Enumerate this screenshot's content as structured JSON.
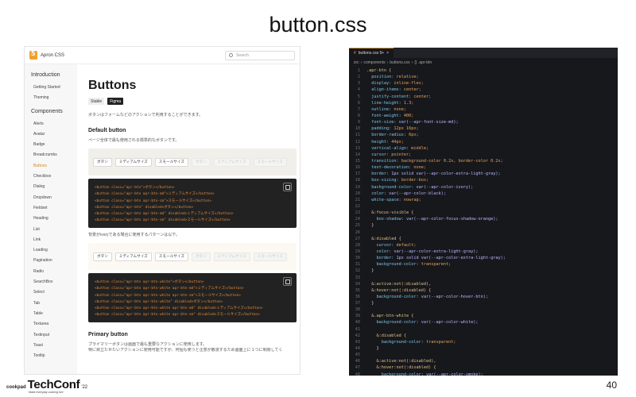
{
  "slide": {
    "title": "button.css",
    "page_number": "40"
  },
  "footer": {
    "cookpad": "cookpad",
    "techconf": "TechConf",
    "year": "'22",
    "tagline": "Make everyday cooking fun!"
  },
  "docs": {
    "brand": "Apron CSS",
    "search_placeholder": "Search",
    "sidebar": {
      "introduction_heading": "Introduction",
      "intro_items": [
        "Getting Started",
        "Theming"
      ],
      "components_heading": "Components",
      "component_items": [
        "Alerts",
        "Avatar",
        "Badge",
        "Breadcrumbs",
        "Buttons",
        "Checkbox",
        "Dialog",
        "Dropdown",
        "Fieldset",
        "Heading",
        "List",
        "Link",
        "Loading",
        "Pagination",
        "Radio",
        "SearchBox",
        "Select",
        "Tab",
        "Table",
        "Textarea",
        "Textinput",
        "Toast",
        "Tooltip"
      ],
      "active_item": "Buttons"
    },
    "page_title": "Buttons",
    "badge_storybook": "Stable",
    "badge_figma": "Figma",
    "intro_text": "ボタンはフォームなどのアクションで利用することができます。",
    "default_heading": "Default button",
    "default_text": "ページ全体で最も使用される標準的なボタンです。",
    "demo_buttons": [
      "ボタン",
      "ミディアムサイズ",
      "スモールサイズ",
      "ボタン",
      "ミディアムサイズ",
      "スモールサイズ"
    ],
    "code_block_1": [
      "<button class=\"apr-btn\">ボタン</button>",
      "<button class=\"apr-btn apr-btn-md\">ミディアムサイズ</button>",
      "<button class=\"apr-btn apr-btn-sm\">スモールサイズ</button>",
      "<button class=\"apr-btn\" disabled>ボタン</button>",
      "<button class=\"apr-btn apr-btn-md\" disabled>ミディアムサイズ</button>",
      "<button class=\"apr-btn apr-btn-sm\" disabled>スモールサイズ</button>"
    ],
    "ivory_text": "背景がivoryである場合に使用するパターンは以下。",
    "code_block_2": [
      "<button class=\"apr-btn apr-btn-white\">ボタン</button>",
      "<button class=\"apr-btn apr-btn-white apr-btn-md\">ミディアムサイズ</button>",
      "<button class=\"apr-btn apr-btn-white apr-btn-sm\">スモールサイズ</button>",
      "<button class=\"apr-btn apr-btn-white\" disabled>ボタン</button>",
      "<button class=\"apr-btn apr-btn-white apr-btn-md\" disabled>ミディアムサイズ</button>",
      "<button class=\"apr-btn apr-btn-white apr-btn-sm\" disabled>スモールサイズ</button>"
    ],
    "primary_heading": "Primary button",
    "primary_text_1": "プライマリーボタンは画面で最も重要なアクションに使用します。",
    "primary_text_2": "特に目立たせたいアクションに使用可能ですが、何個も使うと注意が散漫するため画面上に１つに制限してく"
  },
  "editor": {
    "tab_label": "buttons.css 9+",
    "tab_close": "×",
    "breadcrumb": [
      "src",
      "components",
      "buttons.css",
      "{} .apr-btn"
    ],
    "lines": [
      {
        "n": "1",
        "t": ".apr-btn {",
        "k": "sel"
      },
      {
        "n": "2",
        "t": "  position: relative;",
        "k": "decl"
      },
      {
        "n": "3",
        "t": "  display: inline-flex;",
        "k": "decl"
      },
      {
        "n": "4",
        "t": "  align-items: center;",
        "k": "decl"
      },
      {
        "n": "5",
        "t": "  justify-content: center;",
        "k": "decl"
      },
      {
        "n": "6",
        "t": "  line-height: 1.3;",
        "k": "decl"
      },
      {
        "n": "7",
        "t": "  outline: none;",
        "k": "decl"
      },
      {
        "n": "8",
        "t": "  font-weight: 400;",
        "k": "decl"
      },
      {
        "n": "9",
        "t": "  font-size: var(--apr-font-size-md);",
        "k": "decl"
      },
      {
        "n": "10",
        "t": "  padding: 12px 16px;",
        "k": "decl"
      },
      {
        "n": "11",
        "t": "  border-radius: 6px;",
        "k": "decl"
      },
      {
        "n": "12",
        "t": "  height: 44px;",
        "k": "decl"
      },
      {
        "n": "13",
        "t": "  vertical-align: middle;",
        "k": "decl"
      },
      {
        "n": "14",
        "t": "  cursor: pointer;",
        "k": "decl"
      },
      {
        "n": "15",
        "t": "  transition: background-color 0.2s, border-color 0.2s;",
        "k": "decl"
      },
      {
        "n": "16",
        "t": "  text-decoration: none;",
        "k": "decl"
      },
      {
        "n": "17",
        "t": "  border: 1px solid var(--apr-color-extra-light-gray);",
        "k": "decl"
      },
      {
        "n": "18",
        "t": "  box-sizing: border-box;",
        "k": "decl"
      },
      {
        "n": "19",
        "t": "  background-color: var(--apr-color-ivory);",
        "k": "decl"
      },
      {
        "n": "20",
        "t": "  color: var(--apr-color-black);",
        "k": "decl"
      },
      {
        "n": "21",
        "t": "  white-space: nowrap;",
        "k": "decl"
      },
      {
        "n": "22",
        "t": "",
        "k": "blank"
      },
      {
        "n": "23",
        "t": "  &:focus-visible {",
        "k": "sel"
      },
      {
        "n": "24",
        "t": "    box-shadow: var(--apr-color-focus-shadow-orange);",
        "k": "decl"
      },
      {
        "n": "25",
        "t": "  }",
        "k": "pun"
      },
      {
        "n": "26",
        "t": "",
        "k": "blank"
      },
      {
        "n": "27",
        "t": "  &:disabled {",
        "k": "sel"
      },
      {
        "n": "28",
        "t": "    cursor: default;",
        "k": "decl"
      },
      {
        "n": "29",
        "t": "    color: var(--apr-color-extra-light-gray);",
        "k": "decl"
      },
      {
        "n": "30",
        "t": "    border: 1px solid var(--apr-color-extra-light-gray);",
        "k": "decl"
      },
      {
        "n": "31",
        "t": "    background-color: transparent;",
        "k": "decl"
      },
      {
        "n": "32",
        "t": "  }",
        "k": "pun"
      },
      {
        "n": "33",
        "t": "",
        "k": "blank"
      },
      {
        "n": "34",
        "t": "  &:active:not(:disabled),",
        "k": "sel"
      },
      {
        "n": "35",
        "t": "  &:hover:not(:disabled) {",
        "k": "sel"
      },
      {
        "n": "36",
        "t": "    background-color: var(--apr-color-hover-btn);",
        "k": "decl"
      },
      {
        "n": "37",
        "t": "  }",
        "k": "pun"
      },
      {
        "n": "38",
        "t": "",
        "k": "blank"
      },
      {
        "n": "39",
        "t": "  &.apr-btn-white {",
        "k": "sel"
      },
      {
        "n": "40",
        "t": "    background-color: var(--apr-color-white);",
        "k": "decl"
      },
      {
        "n": "41",
        "t": "",
        "k": "blank"
      },
      {
        "n": "42",
        "t": "    &:disabled {",
        "k": "sel"
      },
      {
        "n": "43",
        "t": "      background-color: transparent;",
        "k": "decl"
      },
      {
        "n": "44",
        "t": "    }",
        "k": "pun"
      },
      {
        "n": "45",
        "t": "",
        "k": "blank"
      },
      {
        "n": "46",
        "t": "    &:active:not(:disabled),",
        "k": "sel"
      },
      {
        "n": "47",
        "t": "    &:hover:not(:disabled) {",
        "k": "sel"
      },
      {
        "n": "48",
        "t": "      background-color: var(--apr-color-smoke);",
        "k": "decl"
      }
    ]
  },
  "colors": {
    "accent": "#e8a23c",
    "editor_bg": "#17181c",
    "active_sidebar": "#d98a10"
  }
}
